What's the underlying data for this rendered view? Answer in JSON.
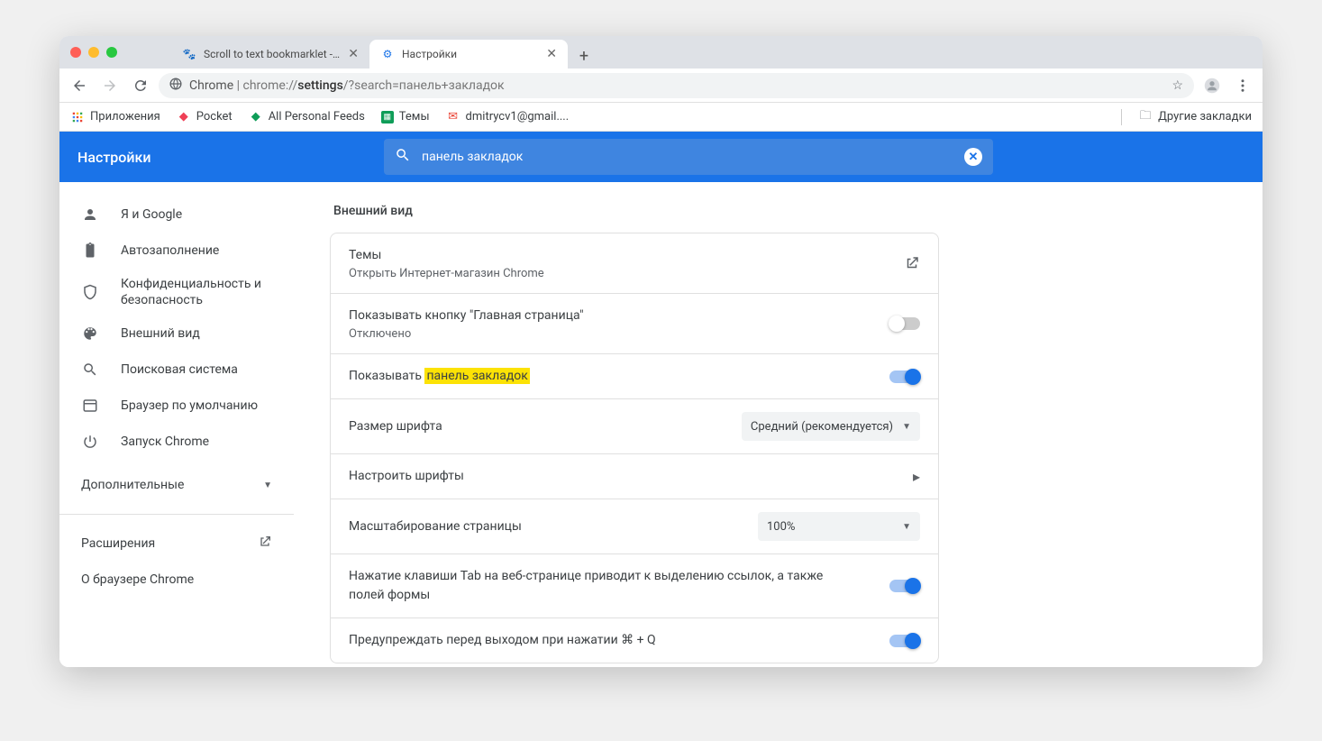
{
  "tabs": [
    {
      "title": "Scroll to text bookmarklet - Me"
    },
    {
      "title": "Настройки"
    }
  ],
  "toolbar": {
    "url_host": "Chrome",
    "url_scheme": "chrome://",
    "url_path": "settings",
    "url_query": "/?search=панель+закладок"
  },
  "bookmarks": {
    "apps": "Приложения",
    "pocket": "Pocket",
    "feeds": "All Personal Feeds",
    "themes": "Темы",
    "gmail": "dmitrycv1@gmail....",
    "other": "Другие закладки"
  },
  "settings": {
    "title": "Настройки",
    "search_value": "панель закладок",
    "sidebar": {
      "me": "Я и Google",
      "autofill": "Автозаполнение",
      "privacy": "Конфиденциальность и безопасность",
      "appearance": "Внешний вид",
      "search": "Поисковая система",
      "default": "Браузер по умолчанию",
      "startup": "Запуск Chrome",
      "advanced": "Дополнительные",
      "extensions": "Расширения",
      "about": "О браузере Chrome"
    },
    "section_title": "Внешний вид",
    "rows": {
      "themes_title": "Темы",
      "themes_sub": "Открыть Интернет-магазин Chrome",
      "home_title": "Показывать кнопку \"Главная страница\"",
      "home_sub": "Отключено",
      "bookmarks_pre": "Показывать ",
      "bookmarks_hl": "панель закладок",
      "fontsize_title": "Размер шрифта",
      "fontsize_value": "Средний (рекомендуется)",
      "customfonts_title": "Настроить шрифты",
      "zoom_title": "Масштабирование страницы",
      "zoom_value": "100%",
      "tab_title": "Нажатие клавиши Tab на веб-странице приводит к выделению ссылок, а также полей формы",
      "quit_title": "Предупреждать перед выходом при нажатии ⌘ + Q"
    }
  }
}
